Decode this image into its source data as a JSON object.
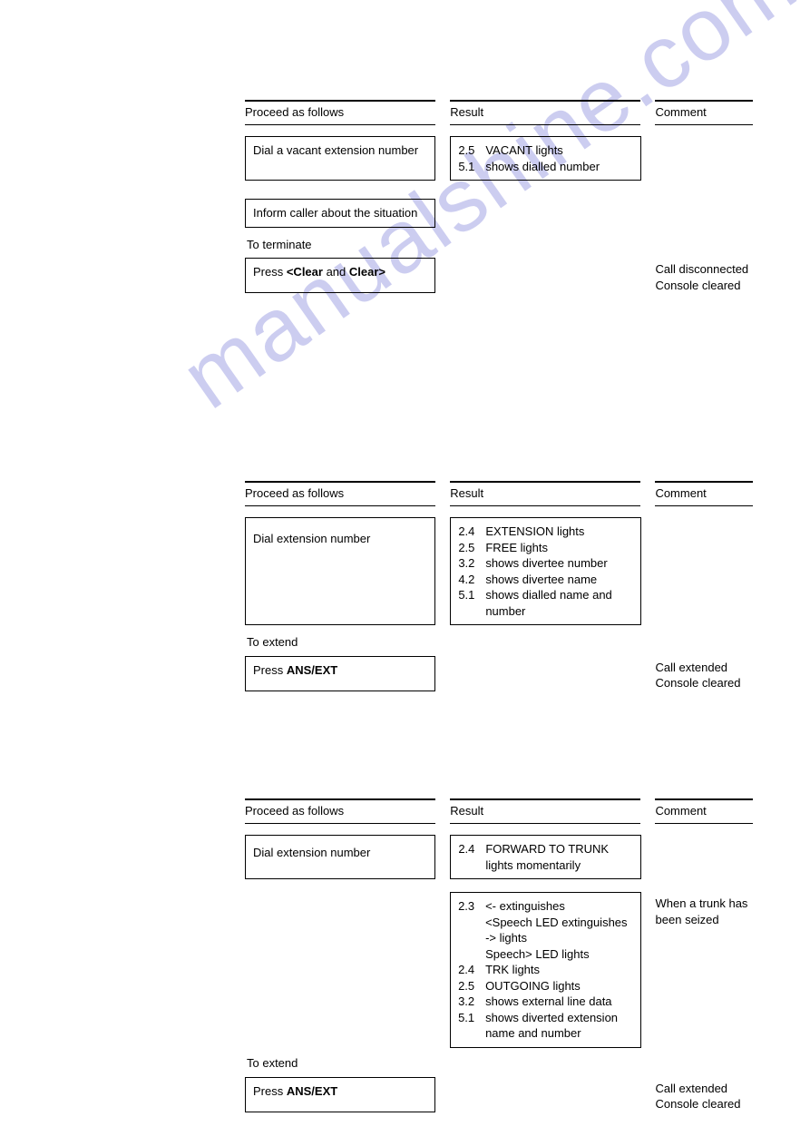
{
  "watermark": "manualshine.com",
  "headers": {
    "proceed": "Proceed as follows",
    "result": "Result",
    "comment": "Comment"
  },
  "sec1": {
    "row1": {
      "proceed": "Dial a vacant extension number",
      "result": [
        {
          "n": "2.5",
          "t": "VACANT lights"
        },
        {
          "n": "5.1",
          "t": "shows dialled number"
        }
      ]
    },
    "row2": {
      "proceed": "Inform caller about the situation"
    },
    "toTerminate": "To terminate",
    "row3": {
      "press_prefix": "Press ",
      "press_bold1": "<Clear",
      "press_mid": " and ",
      "press_bold2": "Clear>",
      "comment_l1": "Call disconnected",
      "comment_l2": "Console cleared"
    }
  },
  "sec2": {
    "row1": {
      "proceed": "Dial extension number",
      "result": [
        {
          "n": "2.4",
          "t": "EXTENSION lights"
        },
        {
          "n": "2.5",
          "t": "FREE lights"
        },
        {
          "n": "3.2",
          "t": "shows divertee number"
        },
        {
          "n": "4.2",
          "t": "shows divertee name"
        },
        {
          "n": "5.1",
          "t": "shows dialled name and number"
        }
      ]
    },
    "toExtend": "To extend",
    "row2": {
      "press_prefix": "Press ",
      "press_bold": "ANS/EXT",
      "comment_l1": "Call extended",
      "comment_l2": "Console cleared"
    }
  },
  "sec3": {
    "row1": {
      "proceed": "Dial extension number",
      "result": [
        {
          "n": "2.4",
          "t": "FORWARD TO TRUNK lights momentarily"
        }
      ]
    },
    "row2": {
      "result": [
        {
          "n": "2.3",
          "t": "<- extinguishes"
        },
        {
          "n": "",
          "t": "<Speech LED extinguishes"
        },
        {
          "n": "",
          "t": "-> lights"
        },
        {
          "n": "",
          "t": "Speech> LED lights"
        },
        {
          "n": "2.4",
          "t": "TRK lights"
        },
        {
          "n": "2.5",
          "t": "OUTGOING lights"
        },
        {
          "n": "3.2",
          "t": "shows external line data"
        },
        {
          "n": "5.1",
          "t": "shows diverted extension name and number"
        }
      ],
      "comment_l1": "When a trunk has",
      "comment_l2": "been seized"
    },
    "toExtend": "To extend",
    "row3": {
      "press_prefix": "Press ",
      "press_bold": "ANS/EXT",
      "comment_l1": "Call extended",
      "comment_l2": "Console cleared"
    }
  }
}
